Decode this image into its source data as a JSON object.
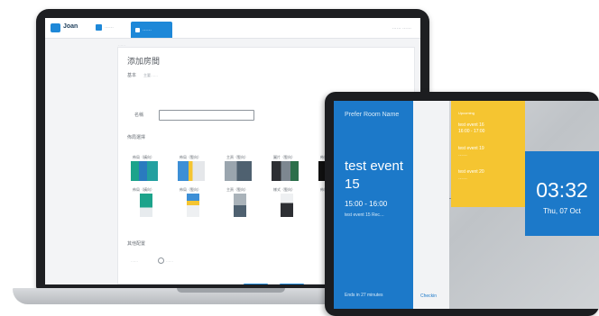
{
  "laptop": {
    "topbar": {
      "brand": "Joan",
      "nav_label": "……",
      "active_tab": "……",
      "user_menu": "…… ……"
    },
    "form": {
      "breadcrumb": "……",
      "title": "添加房間",
      "section_one_label": "基本",
      "section_one_sub": "主要……",
      "name_label": "名稱",
      "name_value": "",
      "template_label": "佈局選擇",
      "templates_row1": [
        "佈局（橫向）",
        "佈局（豎向）",
        "主頁（豎向）",
        "圖片（豎向）",
        "佈局（豎向）"
      ],
      "templates_row2": [
        "佈局（橫向）",
        "佈局（豎向）",
        "主頁（豎向）",
        "樣式（豎向）",
        "佈局（豎向）"
      ],
      "section_two_label": "其他配置",
      "radio_label": "……",
      "radio_option": "……",
      "buttons": {
        "cancel": "取消",
        "confirm": "確定"
      }
    }
  },
  "tablet": {
    "room_name": "Prefer Room Name",
    "event_title": "test event",
    "event_number": "15",
    "event_time": "15:00 - 16:00",
    "event_desc": "test event 15 Rec…",
    "ends_in": "Ends in 27 minutes",
    "checkin": "Checkin",
    "upcoming_header": "Upcoming",
    "upcoming": [
      {
        "title": "test event 16",
        "time": "16:00 - 17:00"
      },
      {
        "title": "test event 19",
        "time": "……"
      },
      {
        "title": "test event 20",
        "time": "……"
      }
    ],
    "clock": {
      "time": "03:32",
      "date": "Thu, 07 Oct"
    }
  },
  "colors": {
    "brand_blue": "#1c79c9",
    "accent_yellow": "#f5c531",
    "device_frame": "#1c1d20"
  }
}
